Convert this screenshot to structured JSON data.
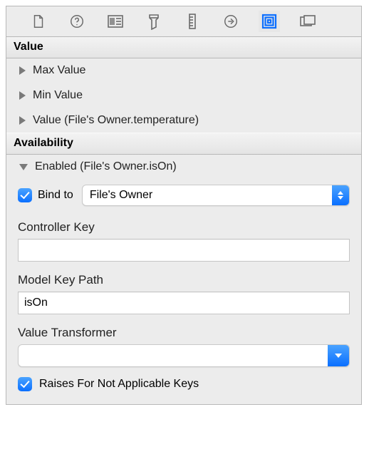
{
  "toolbar": {
    "icons": [
      {
        "name": "file-icon"
      },
      {
        "name": "help-icon"
      },
      {
        "name": "identity-icon"
      },
      {
        "name": "attributes-icon"
      },
      {
        "name": "size-icon"
      },
      {
        "name": "connections-icon"
      },
      {
        "name": "bindings-icon",
        "selected": true
      },
      {
        "name": "effects-icon"
      }
    ]
  },
  "sections": {
    "value": {
      "title": "Value",
      "rows": [
        {
          "label": "Max Value",
          "expanded": false
        },
        {
          "label": "Min Value",
          "expanded": false
        },
        {
          "label": "Value (File's Owner.temperature)",
          "expanded": false
        }
      ]
    },
    "availability": {
      "title": "Availability",
      "enabled_row": {
        "label": "Enabled (File's Owner.isOn)",
        "expanded": true
      },
      "bind_to": {
        "checkbox": true,
        "label": "Bind to",
        "value": "File's Owner"
      },
      "controller_key": {
        "label": "Controller Key",
        "value": ""
      },
      "model_key_path": {
        "label": "Model Key Path",
        "value": "isOn"
      },
      "value_transformer": {
        "label": "Value Transformer",
        "value": ""
      },
      "raises": {
        "checked": true,
        "label": "Raises For Not Applicable Keys"
      }
    }
  }
}
